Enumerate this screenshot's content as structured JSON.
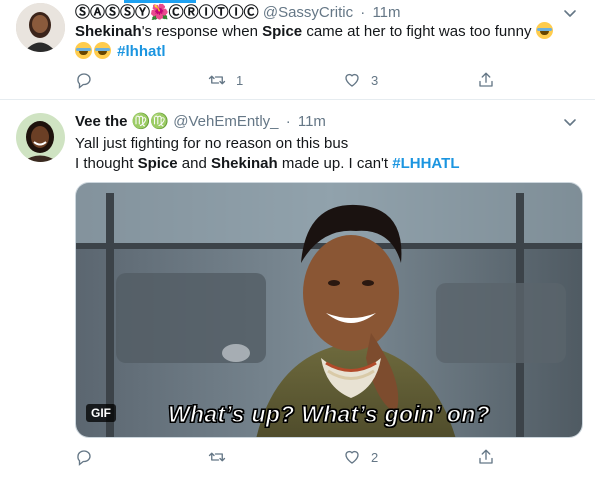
{
  "tweets": [
    {
      "author": {
        "name": "ⓈⒶⓈⓈⓎ🌺ⒸⓇⒾⓉⒾⒸ",
        "handle": "@SassyCritic",
        "time": "11m"
      },
      "text": {
        "part1": "Shekinah",
        "part2": "'s response when ",
        "part3": "Spice",
        "part4": " came at her to fight was too funny ",
        "hashtag": "#lhhatl"
      },
      "actions": {
        "replies": "",
        "retweets": "1",
        "likes": "3"
      }
    },
    {
      "author": {
        "name": "Vee the ♍♍",
        "handle": "@VehEmEntly_",
        "time": "11m"
      },
      "text": {
        "line1": "Yall just fighting for no reason on this bus",
        "line2_part1": "I thought ",
        "line2_part2": "Spice",
        "line2_part3": " and ",
        "line2_part4": "Shekinah",
        "line2_part5": " made up. I can't ",
        "hashtag": "#LHHATL"
      },
      "media": {
        "badge": "GIF",
        "caption": "What’s up? What’s goin’ on?"
      },
      "actions": {
        "replies": "",
        "retweets": "",
        "likes": "2"
      }
    }
  ],
  "icons": {
    "reply": "reply-icon",
    "retweet": "retweet-icon",
    "like": "heart-icon",
    "share": "share-icon",
    "more": "chevron-down-icon"
  },
  "colors": {
    "accent": "#1da1f2",
    "hashtag": "#1b95e0",
    "muted": "#657786",
    "divider": "#e6ecf0"
  }
}
